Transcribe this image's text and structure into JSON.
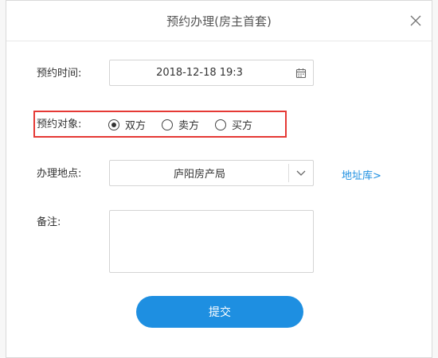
{
  "dialog": {
    "title": "预约办理(房主首套)",
    "close_icon": "close-icon"
  },
  "form": {
    "time": {
      "label": "预约时间:",
      "value": "2018-12-18 19:3",
      "icon": "calendar-icon"
    },
    "target": {
      "label": "预约对象:",
      "options": [
        {
          "label": "双方",
          "checked": true
        },
        {
          "label": "卖方",
          "checked": false
        },
        {
          "label": "买方",
          "checked": false
        }
      ],
      "highlight_color": "#e53935"
    },
    "location": {
      "label": "办理地点:",
      "value": "庐阳房产局",
      "icon": "chevron-down-icon",
      "link": "地址库>"
    },
    "remark": {
      "label": "备注:",
      "value": ""
    }
  },
  "submit": {
    "label": "提交",
    "color": "#1e8fe1"
  }
}
